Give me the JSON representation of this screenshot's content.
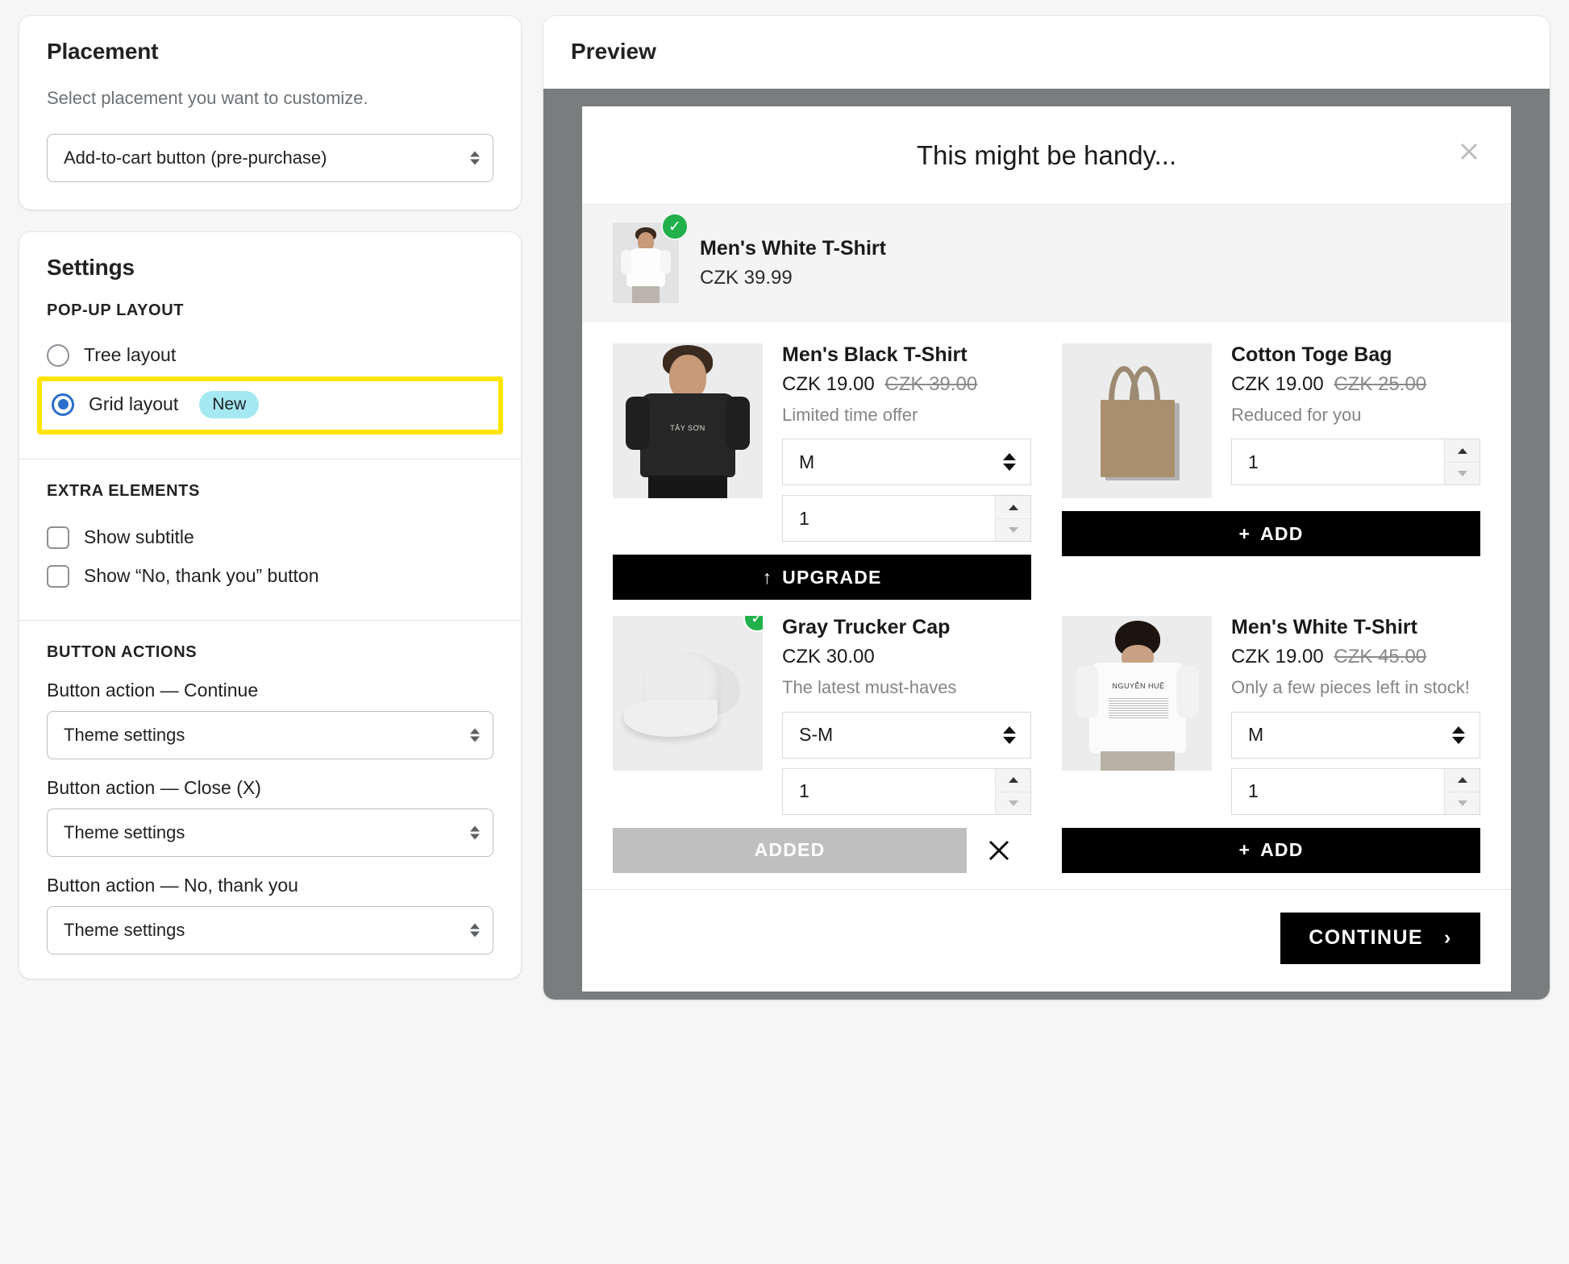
{
  "placement": {
    "title": "Placement",
    "help": "Select placement you want to customize.",
    "select_value": "Add-to-cart button (pre-purchase)"
  },
  "settings": {
    "title": "Settings",
    "popup_layout": {
      "label": "POP-UP LAYOUT",
      "options": [
        {
          "label": "Tree layout",
          "selected": false,
          "badge": ""
        },
        {
          "label": "Grid layout",
          "selected": true,
          "badge": "New"
        }
      ]
    },
    "extra_elements": {
      "label": "EXTRA ELEMENTS",
      "options": [
        {
          "label": "Show subtitle",
          "checked": false
        },
        {
          "label": "Show “No, thank you” button",
          "checked": false
        }
      ]
    },
    "button_actions": {
      "label": "BUTTON ACTIONS",
      "fields": [
        {
          "label": "Button action — Continue",
          "value": "Theme settings"
        },
        {
          "label": "Button action — Close (X)",
          "value": "Theme settings"
        },
        {
          "label": "Button action — No, thank you",
          "value": "Theme settings"
        }
      ]
    }
  },
  "preview": {
    "title": "Preview",
    "modal": {
      "heading": "This might be handy...",
      "close_label": "✕",
      "cart_item": {
        "name": "Men's White T-Shirt",
        "price": "CZK 39.99",
        "check": "✓"
      },
      "products": [
        {
          "name": "Men's Black T-Shirt",
          "price": "CZK 19.00",
          "compare_price": "CZK 39.00",
          "note": "Limited time offer",
          "variant": "M",
          "quantity": "1",
          "action_label": "UPGRADE",
          "action_icon": "↑",
          "state": "upgrade",
          "added_check": false
        },
        {
          "name": "Cotton Toge Bag",
          "price": "CZK 19.00",
          "compare_price": "CZK 25.00",
          "note": "Reduced for you",
          "variant": "",
          "quantity": "1",
          "action_label": "ADD",
          "action_icon": "+",
          "state": "add",
          "added_check": false
        },
        {
          "name": "Gray Trucker Cap",
          "price": "CZK 30.00",
          "compare_price": "",
          "note": "The latest must-haves",
          "variant": "S-M",
          "quantity": "1",
          "action_label": "ADDED",
          "action_icon": "",
          "state": "added",
          "remove_icon": "✕",
          "added_check": true
        },
        {
          "name": "Men's White T-Shirt",
          "price": "CZK 19.00",
          "compare_price": "CZK 45.00",
          "note": "Only a few pieces left in stock!",
          "variant": "M",
          "quantity": "1",
          "action_label": "ADD",
          "action_icon": "+",
          "state": "add",
          "added_check": false
        }
      ],
      "continue_label": "CONTINUE",
      "continue_icon": "›"
    }
  },
  "colors": {
    "accent_radio": "#2c6ecb",
    "highlight": "#ffe500",
    "badge_new_bg": "#a4e8f2",
    "check_green": "#21b04b",
    "backdrop": "#7a7d7d",
    "button_black": "#000000",
    "button_added": "#bfbfbf"
  }
}
